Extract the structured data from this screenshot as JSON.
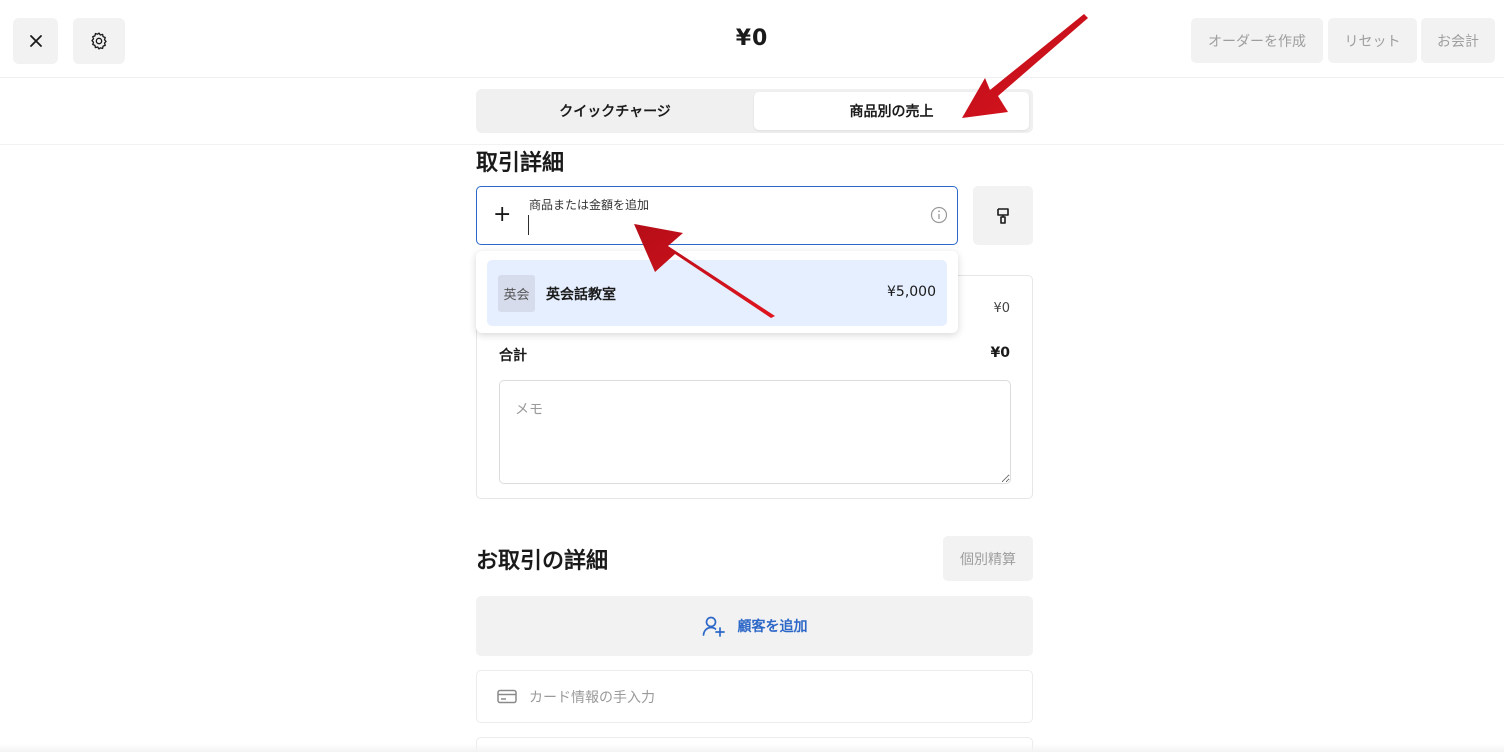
{
  "header": {
    "amount": "¥0",
    "actions": {
      "create_order": "オーダーを作成",
      "reset": "リセット",
      "checkout": "お会計"
    }
  },
  "tabs": {
    "quick_charge": "クイックチャージ",
    "item_sales": "商品別の売上"
  },
  "details": {
    "title": "取引詳細",
    "search_label": "商品または金額を追加",
    "subtotal_value": "¥0",
    "total_label": "合計",
    "total_value": "¥0",
    "memo_placeholder": "メモ"
  },
  "dropdown": {
    "items": [
      {
        "thumb": "英会",
        "name": "英会話教室",
        "price": "¥5,000"
      }
    ]
  },
  "transaction": {
    "title": "お取引の詳細",
    "split_button": "個別精算",
    "add_customer": "顧客を追加",
    "card_entry": "カード情報の手入力"
  },
  "colors": {
    "accent": "#2d68c8",
    "annotation_arrow": "#d8121c",
    "selected_row": "#e6efff"
  },
  "icons": [
    "close-icon",
    "settings-gear-icon",
    "plus-icon",
    "info-icon",
    "brush-icon",
    "person-add-icon",
    "credit-card-icon"
  ]
}
